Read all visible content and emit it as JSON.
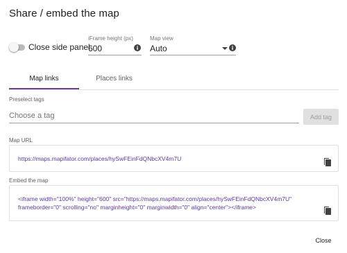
{
  "dialog": {
    "title": "Share / embed the map"
  },
  "options": {
    "toggle_label": "Close side panel",
    "toggle_on": false,
    "iframe_height": {
      "label": "iFrame height (px)",
      "value": "600"
    },
    "map_view": {
      "label": "Map view",
      "value": "Auto"
    }
  },
  "tabs": [
    {
      "label": "Map links",
      "active": true
    },
    {
      "label": "Places links",
      "active": false
    }
  ],
  "preselect": {
    "label": "Preselect tags",
    "placeholder": "Choose a tag",
    "add_button": "Add tag"
  },
  "map_url": {
    "label": "Map URL",
    "value": "https://maps.mapifator.com/places/hySwFEinFdQNbcXV4m7U"
  },
  "embed": {
    "label": "Embed the map",
    "line1": "<iframe width=\"100%\" height=\"600\" src=\"https://maps.mapifator.com/places/hySwFEinFdQNbcXV4m7U\"",
    "line2": "frameborder=\"0\" scrolling=\"no\" marginheight=\"0\" marginwidth=\"0\" align=\"center\"></iframe>"
  },
  "footer": {
    "close_label": "Close"
  },
  "colors": {
    "accent": "#673ab7",
    "link": "#5e35b1"
  },
  "icons": {
    "info": "info-icon",
    "copy": "copy-icon",
    "dropdown": "caret-down-icon"
  }
}
